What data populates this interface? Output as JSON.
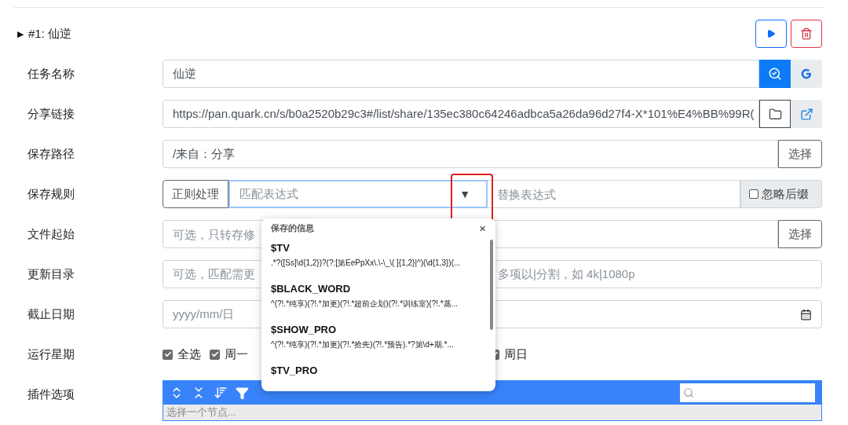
{
  "task": {
    "toggle": "▶",
    "title": "#1: 仙逆",
    "expanded": false
  },
  "fields": [
    {
      "kind": "name",
      "label": "任务名称",
      "value": "仙逆"
    },
    {
      "kind": "link",
      "label": "分享链接",
      "value": "https://pan.quark.cn/s/b0a2520b29c3#/list/share/135ec380c64246adbca5a26da96d27f4-X*101%E4%BB%99R("
    },
    {
      "kind": "path",
      "label": "保存路径",
      "value": "/来自：分享",
      "button": "选择"
    },
    {
      "kind": "rule",
      "label": "保存规则",
      "button": "正则处理",
      "pattern_placeholder": "匹配表达式",
      "caret": "▼",
      "replace_placeholder": "替换表达式",
      "ignore_label": "忽略后缀",
      "ignore_checked": false
    },
    {
      "kind": "path",
      "label": "文件起始",
      "placeholder": "可选，只转存修",
      "button": "选择"
    },
    {
      "kind": "text",
      "label": "更新目录",
      "placeholder_left": "可选，匹配需更",
      "placeholder_right": "多项以|分割，如 4k|1080p"
    },
    {
      "kind": "date",
      "label": "截止日期",
      "placeholder": "yyyy/mm/日"
    },
    {
      "kind": "weekdays",
      "label": "运行星期",
      "left": [
        {
          "label": "全选",
          "checked": true
        },
        {
          "label": "周一",
          "checked": true
        }
      ],
      "right": [
        {
          "label": "周日",
          "checked": true
        }
      ]
    },
    {
      "kind": "plugins",
      "label": "插件选项",
      "status": "选择一个节点..."
    }
  ],
  "popup": {
    "title": "保存的信息",
    "close": "×",
    "items": [
      {
        "name": "$TV",
        "pattern": ".*?([Ss]\\d{1,2})?(?:[第EePpXx\\.\\-\\_\\( ]{1,2}|^)(\\d{1,3})(..."
      },
      {
        "name": "$BLACK_WORD",
        "pattern": "^(?!.*纯享)(?!.*加更)(?!.*超前企划)(?!.*训练室)(?!.*蒸..."
      },
      {
        "name": "$SHOW_PRO",
        "pattern": "^(?!.*纯享)(?!.*加更)(?!.*抢先)(?!.*预告).*?第\\d+期.*..."
      },
      {
        "name": "$TV_PRO"
      }
    ]
  }
}
